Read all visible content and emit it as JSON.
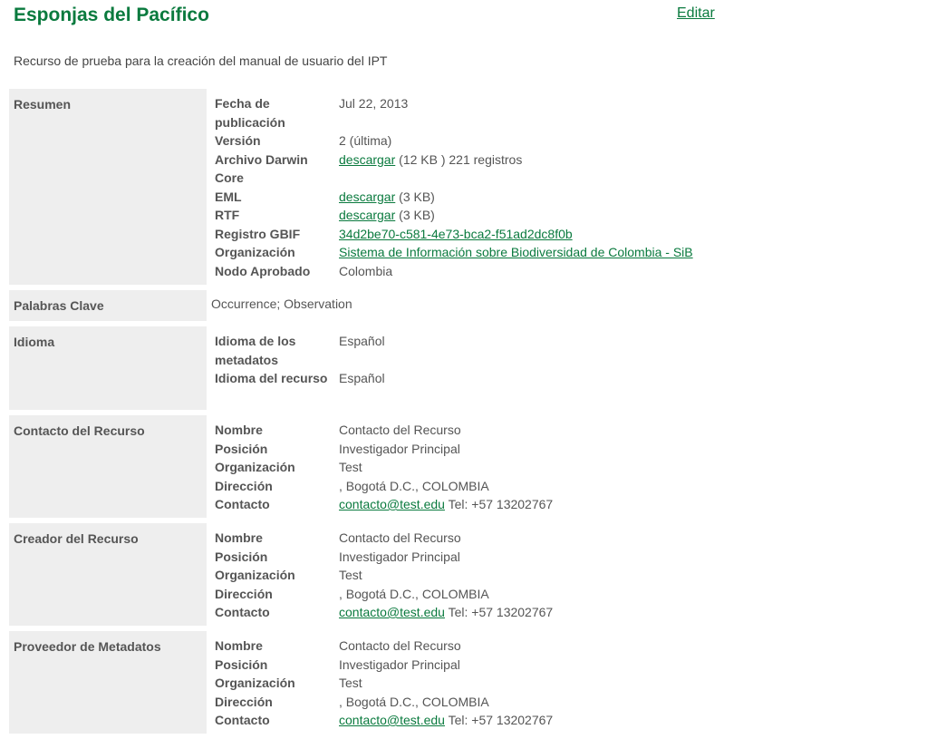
{
  "header": {
    "title": "Esponjas del Pacífico",
    "edit_label": "Editar",
    "description": "Recurso de prueba para la creación del manual de usuario del IPT"
  },
  "resumen": {
    "label": "Resumen",
    "fecha_key": "Fecha de publicación",
    "fecha_val": "Jul 22, 2013",
    "version_key": "Versión",
    "version_val": "2 (última)",
    "dwc_key": "Archivo Darwin Core",
    "dwc_link": "descargar",
    "dwc_rest": " (12 KB ) 221 registros",
    "eml_key": "EML",
    "eml_link": "descargar",
    "eml_rest": " (3 KB)",
    "rtf_key": "RTF",
    "rtf_link": "descargar",
    "rtf_rest": " (3 KB)",
    "gbif_key": "Registro GBIF",
    "gbif_link": "34d2be70-c581-4e73-bca2-f51ad2dc8f0b",
    "org_key": "Organización",
    "org_link": "Sistema de Información sobre Biodiversidad de Colombia - SiB",
    "nodo_key": "Nodo Aprobado",
    "nodo_val": "Colombia"
  },
  "palabras": {
    "label": "Palabras Clave",
    "value": "Occurrence; Observation"
  },
  "idioma": {
    "label": "Idioma",
    "meta_key": "Idioma de los metadatos",
    "meta_val": "Español",
    "rec_key": "Idioma del recurso",
    "rec_val": "Español"
  },
  "contacts": [
    {
      "label": "Contacto del Recurso",
      "nombre_key": "Nombre",
      "nombre_val": "Contacto del Recurso",
      "posicion_key": "Posición",
      "posicion_val": "Investigador Principal",
      "org_key": "Organización",
      "org_val": "Test",
      "dir_key": "Dirección",
      "dir_val": ", Bogotá D.C., COLOMBIA",
      "contacto_key": "Contacto",
      "email": "contacto@test.edu",
      "tel": " Tel: +57 13202767"
    },
    {
      "label": "Creador del Recurso",
      "nombre_key": "Nombre",
      "nombre_val": "Contacto del Recurso",
      "posicion_key": "Posición",
      "posicion_val": "Investigador Principal",
      "org_key": "Organización",
      "org_val": "Test",
      "dir_key": "Dirección",
      "dir_val": ", Bogotá D.C., COLOMBIA",
      "contacto_key": "Contacto",
      "email": "contacto@test.edu",
      "tel": " Tel: +57 13202767"
    },
    {
      "label": "Proveedor de Metadatos",
      "nombre_key": "Nombre",
      "nombre_val": "Contacto del Recurso",
      "posicion_key": "Posición",
      "posicion_val": "Investigador Principal",
      "org_key": "Organización",
      "org_val": "Test",
      "dir_key": "Dirección",
      "dir_val": ", Bogotá D.C., COLOMBIA",
      "contacto_key": "Contacto",
      "email": "contacto@test.edu",
      "tel": " Tel: +57 13202767"
    }
  ]
}
